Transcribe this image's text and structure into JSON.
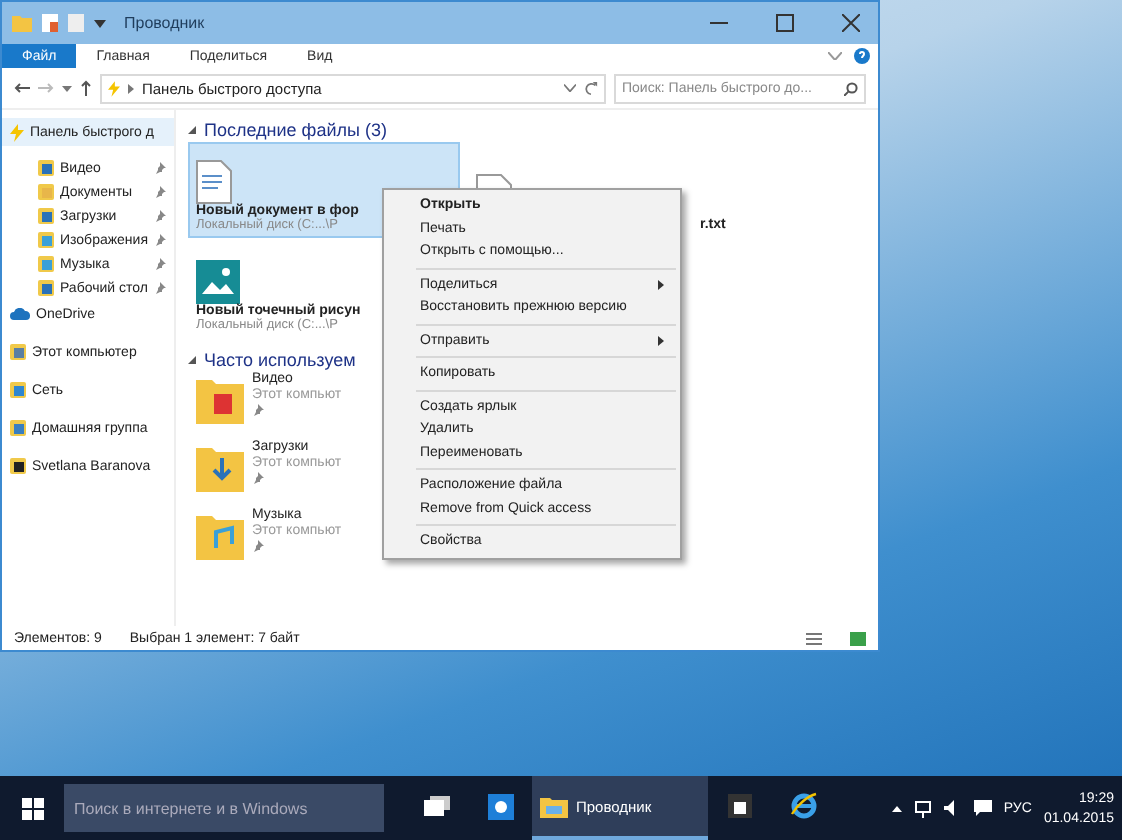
{
  "window": {
    "title": "Проводник"
  },
  "ribbon": {
    "tabs": [
      {
        "label": "Файл",
        "kind": "file"
      },
      {
        "label": "Главная",
        "kind": "tab"
      },
      {
        "label": "Поделиться",
        "kind": "tab"
      },
      {
        "label": "Вид",
        "kind": "tab"
      }
    ]
  },
  "address": {
    "path": "Панель быстрого доступа",
    "search_placeholder": "Поиск: Панель быстрого до..."
  },
  "sidebar": [
    {
      "label": "Панель быстрого д",
      "kind": "quick",
      "selected": true,
      "children": [
        {
          "label": "Видео",
          "kind": "video",
          "pinned": true
        },
        {
          "label": "Документы",
          "kind": "documents",
          "pinned": true
        },
        {
          "label": "Загрузки",
          "kind": "downloads",
          "pinned": true
        },
        {
          "label": "Изображения",
          "kind": "pictures",
          "pinned": true
        },
        {
          "label": "Музыка",
          "kind": "music",
          "pinned": true
        },
        {
          "label": "Рабочий стол",
          "kind": "desktop",
          "pinned": true
        }
      ]
    },
    {
      "label": "OneDrive",
      "kind": "onedrive",
      "selected": false
    },
    {
      "label": "Этот компьютер",
      "kind": "computer",
      "selected": false
    },
    {
      "label": "Сеть",
      "kind": "network",
      "selected": false
    },
    {
      "label": "Домашняя группа",
      "kind": "homegroup",
      "selected": false
    },
    {
      "label": "Svetlana Baranova",
      "kind": "user",
      "selected": false
    }
  ],
  "sections": [
    {
      "title": "Последние файлы (3)",
      "expanded": true,
      "kind": "tiles",
      "items": [
        {
          "name": "Новый документ в фор",
          "location": "Локальный диск (C:...\\P",
          "kind": "document",
          "selected": true
        },
        {
          "name": "r.txt",
          "kind": "text",
          "selected": false
        },
        {
          "name": "Новый точечный рисун",
          "location": "Локальный диск (C:...\\P",
          "kind": "image",
          "selected": false
        }
      ]
    },
    {
      "title": "Часто используем",
      "expanded": true,
      "kind": "folders",
      "items": [
        {
          "name": "Видео",
          "location": "Этот компьют",
          "kind": "video",
          "pinned": true
        },
        {
          "name": "Загрузки",
          "location": "Этот компьют",
          "kind": "downloads",
          "pinned": true
        },
        {
          "name": "Музыка",
          "location": "Этот компьют",
          "kind": "music",
          "pinned": true
        }
      ]
    }
  ],
  "context_menu": {
    "groups": [
      [
        {
          "label": "Открыть",
          "default": true,
          "submenu": false
        },
        {
          "label": "Печать",
          "default": false,
          "submenu": false
        },
        {
          "label": "Открыть с помощью...",
          "default": false,
          "submenu": false
        }
      ],
      [
        {
          "label": "Поделиться",
          "default": false,
          "submenu": true
        },
        {
          "label": "Восстановить прежнюю версию",
          "default": false,
          "submenu": false
        }
      ],
      [
        {
          "label": "Отправить",
          "default": false,
          "submenu": true
        }
      ],
      [
        {
          "label": "Копировать",
          "default": false,
          "submenu": false
        }
      ],
      [
        {
          "label": "Создать ярлык",
          "default": false,
          "submenu": false
        },
        {
          "label": "Удалить",
          "default": false,
          "submenu": false
        },
        {
          "label": "Переименовать",
          "default": false,
          "submenu": false
        }
      ],
      [
        {
          "label": "Расположение файла",
          "default": false,
          "submenu": false
        },
        {
          "label": "Remove from Quick access",
          "default": false,
          "submenu": false
        }
      ],
      [
        {
          "label": "Свойства",
          "default": false,
          "submenu": false
        }
      ]
    ]
  },
  "status_bar": {
    "count": "Элементов: 9",
    "selection": "Выбран 1 элемент: 7 байт"
  },
  "taskbar": {
    "search_placeholder": "Поиск в интернете и в Windows",
    "apps": [
      {
        "kind": "task-view",
        "active": false
      },
      {
        "kind": "blue-app",
        "active": false
      },
      {
        "kind": "explorer",
        "label": "Проводник",
        "active": true
      },
      {
        "kind": "store",
        "active": false
      },
      {
        "kind": "ie",
        "active": false
      }
    ],
    "language": "РУС",
    "time": "19:29",
    "date": "01.04.2015"
  }
}
